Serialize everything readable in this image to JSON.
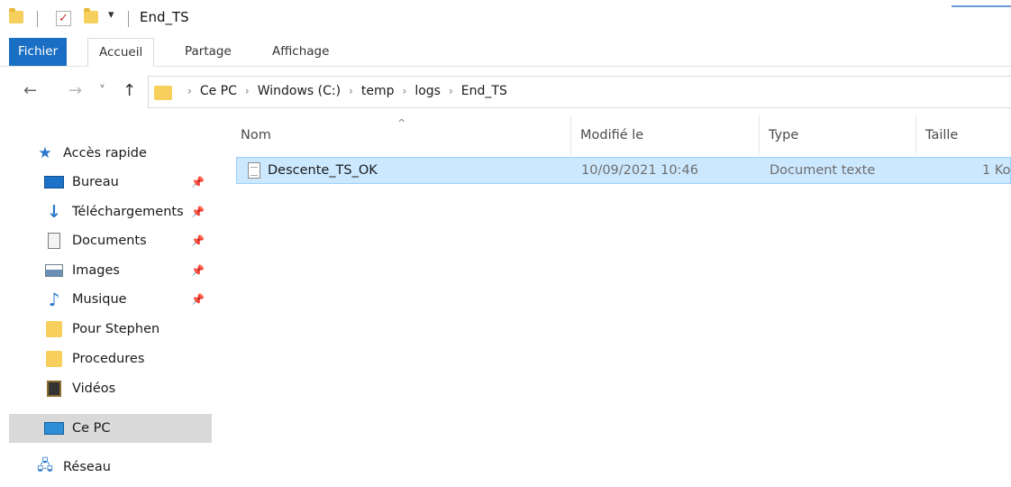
{
  "window": {
    "title": "End_TS",
    "quick_access_dropdown": "▾"
  },
  "ribbon": {
    "tabs": [
      {
        "label": "Fichier"
      },
      {
        "label": "Accueil"
      },
      {
        "label": "Partage"
      },
      {
        "label": "Affichage"
      }
    ]
  },
  "nav_buttons": {
    "back": "←",
    "forward": "→",
    "recent": "˅",
    "up": "↑"
  },
  "breadcrumb": {
    "separator": "›",
    "items": [
      "Ce PC",
      "Windows (C:)",
      "temp",
      "logs",
      "End_TS"
    ]
  },
  "sidebar": {
    "pin_glyph": "📌",
    "items": [
      {
        "label": "Accès rapide",
        "icon": "star-icon"
      },
      {
        "label": "Bureau",
        "icon": "desktop-icon",
        "pinned": true
      },
      {
        "label": "Téléchargements",
        "icon": "download-icon",
        "pinned": true
      },
      {
        "label": "Documents",
        "icon": "documents-icon",
        "pinned": true
      },
      {
        "label": "Images",
        "icon": "images-icon",
        "pinned": true
      },
      {
        "label": "Musique",
        "icon": "music-icon",
        "pinned": true
      },
      {
        "label": "Pour Stephen",
        "icon": "folder-icon"
      },
      {
        "label": "Procedures",
        "icon": "folder-icon"
      },
      {
        "label": "Vidéos",
        "icon": "video-icon"
      },
      {
        "label": "Ce PC",
        "icon": "pc-icon",
        "selected": true
      },
      {
        "label": "Réseau",
        "icon": "network-icon"
      }
    ]
  },
  "file_list": {
    "sort_indicator": "^",
    "columns": [
      "Nom",
      "Modifié le",
      "Type",
      "Taille"
    ],
    "rows": [
      {
        "name": "Descente_TS_OK",
        "modified": "10/09/2021 10:46",
        "type": "Document texte",
        "size": "1 Ko",
        "selected": true
      }
    ]
  },
  "colors": {
    "accent": "#1a6fc4",
    "selection": "#cce8ff",
    "folder": "#f6cf5c"
  }
}
